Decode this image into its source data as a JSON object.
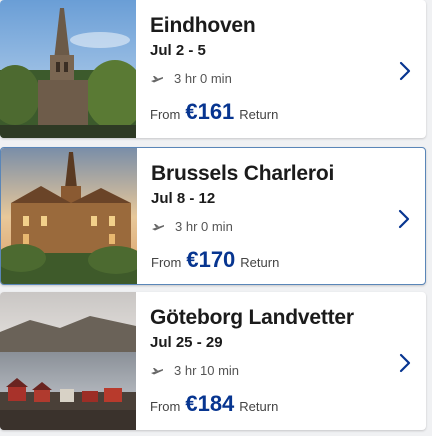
{
  "flights": [
    {
      "city": "Eindhoven",
      "dates": "Jul 2 - 5",
      "duration": "3 hr 0 min",
      "from_label": "From",
      "price": "€161",
      "trip_type": "Return",
      "image": "eindhoven-church-photo"
    },
    {
      "city": "Brussels Charleroi",
      "dates": "Jul 8 - 12",
      "duration": "3 hr 0 min",
      "from_label": "From",
      "price": "€170",
      "trip_type": "Return",
      "image": "brussels-castle-photo"
    },
    {
      "city": "Göteborg Landvetter",
      "dates": "Jul 25 - 29",
      "duration": "3 hr 10 min",
      "from_label": "From",
      "price": "€184",
      "trip_type": "Return",
      "image": "goteborg-harbour-photo"
    }
  ],
  "colors": {
    "price": "#073590",
    "chevron": "#073590",
    "selected_border": "#5a86b8"
  },
  "icons": {
    "plane": "plane-icon",
    "chevron": "chevron-right-icon"
  }
}
